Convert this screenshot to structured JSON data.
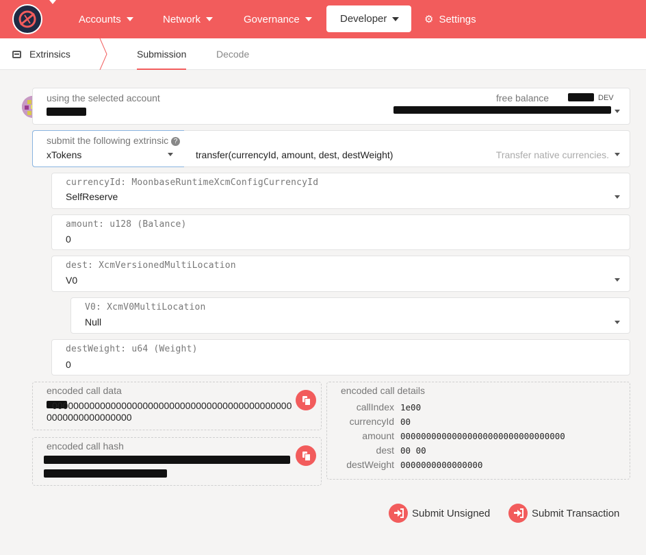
{
  "nav": {
    "items": [
      "Accounts",
      "Network",
      "Governance",
      "Developer",
      "Settings"
    ]
  },
  "subnav": {
    "section": "Extrinsics",
    "tabs": [
      "Submission",
      "Decode"
    ]
  },
  "account": {
    "label": "using the selected account",
    "balance_label": "free balance",
    "balance_unit": "DEV"
  },
  "extrinsic": {
    "label": "submit the following extrinsic",
    "help": "?",
    "module": "xTokens",
    "method": "transfer(currencyId, amount, dest, destWeight)",
    "description": "Transfer native currencies."
  },
  "params": [
    {
      "label": "currencyId: MoonbaseRuntimeXcmConfigCurrencyId",
      "value": "SelfReserve"
    },
    {
      "label": "amount: u128 (Balance)",
      "value": "0"
    },
    {
      "label": "dest: XcmVersionedMultiLocation",
      "value": "V0"
    },
    {
      "label": "V0: XcmV0MultiLocation",
      "value": "Null"
    },
    {
      "label": "destWeight: u64 (Weight)",
      "value": "0"
    }
  ],
  "encoded": {
    "call_data_label": "encoded call data",
    "call_data_line1": "000000000000000000000000000000000000000000000",
    "call_data_line2": "0000000000000000",
    "call_hash_label": "encoded call hash",
    "details_label": "encoded call details"
  },
  "details": [
    {
      "key": "callIndex",
      "value": "1e00"
    },
    {
      "key": "currencyId",
      "value": "00"
    },
    {
      "key": "amount",
      "value": "00000000000000000000000000000000"
    },
    {
      "key": "dest",
      "value": "00 00"
    },
    {
      "key": "destWeight",
      "value": "0000000000000000"
    }
  ],
  "actions": {
    "submit_unsigned": "Submit Unsigned",
    "submit_transaction": "Submit Transaction"
  },
  "colors": {
    "accent": "#f25c5c",
    "background": "#f5f4f3"
  }
}
